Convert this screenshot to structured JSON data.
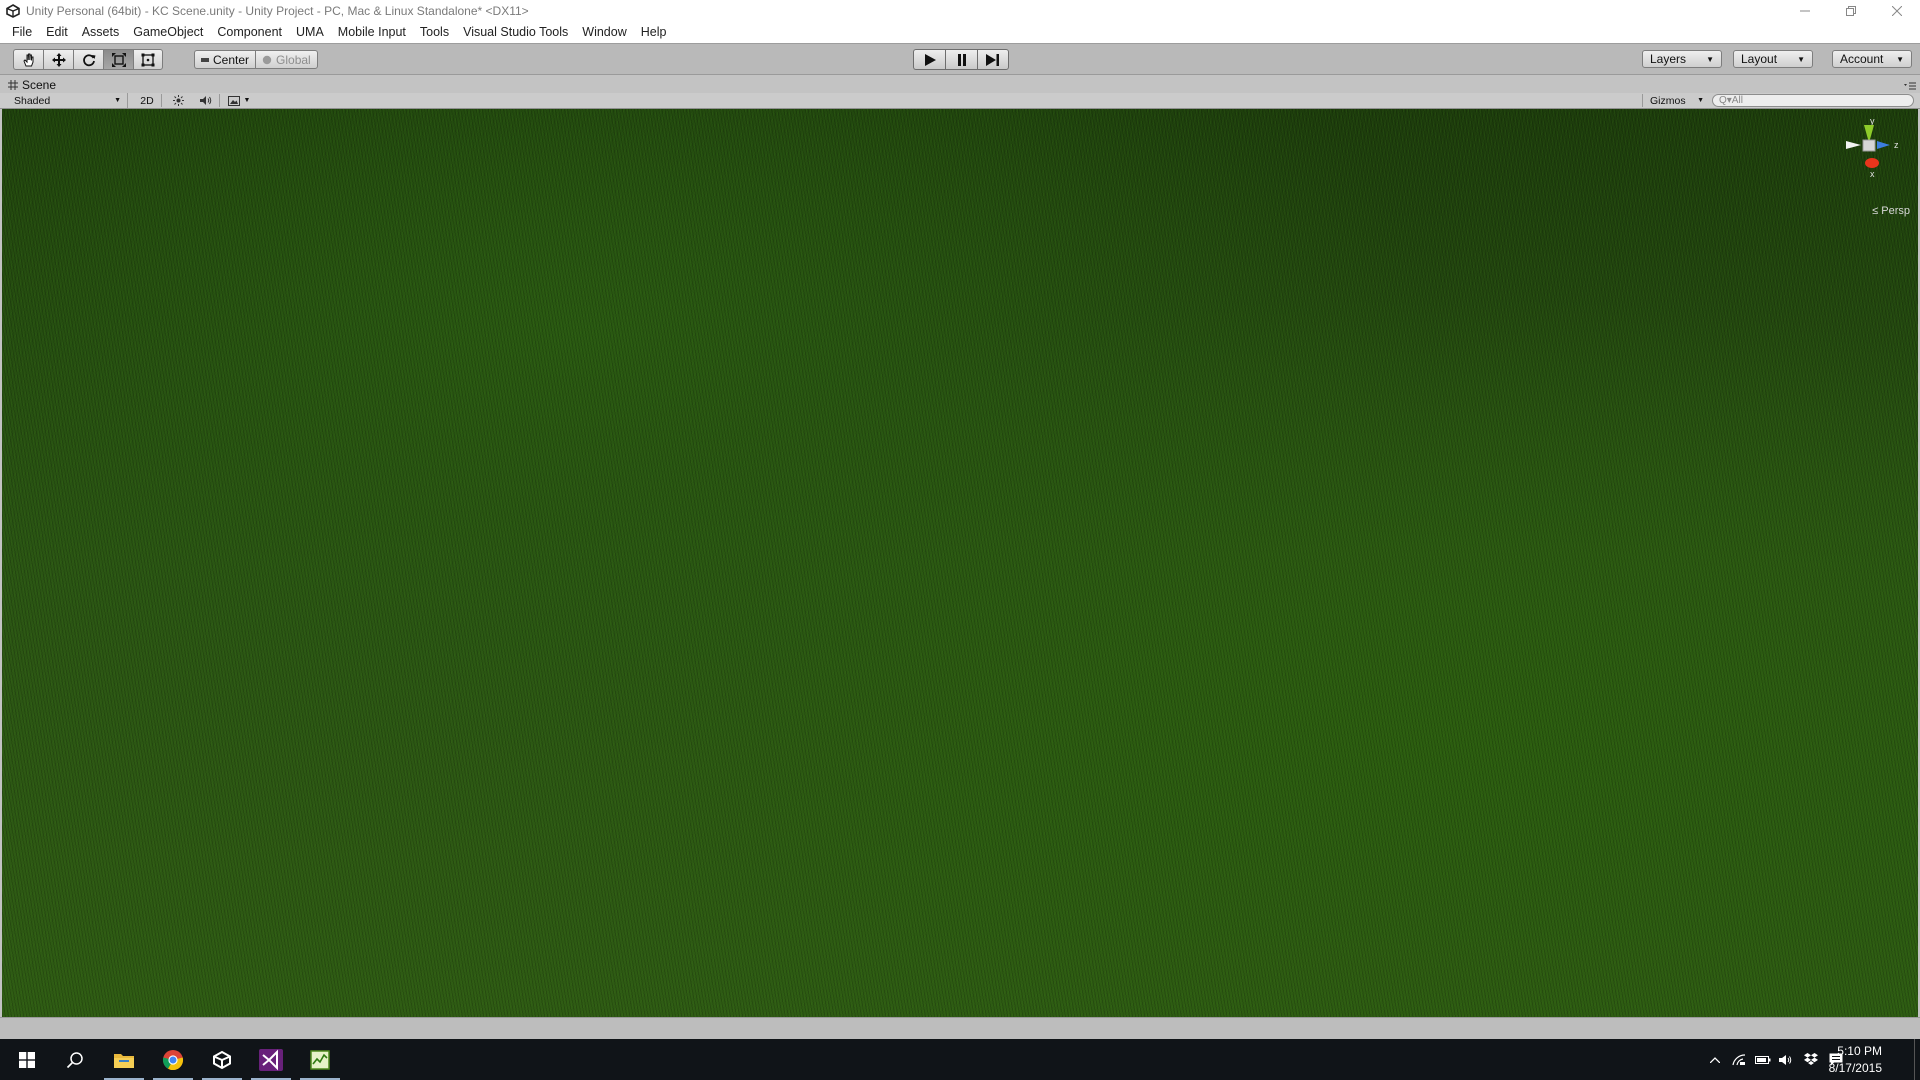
{
  "window": {
    "title": "Unity Personal (64bit) - KC Scene.unity - Unity Project - PC, Mac & Linux Standalone* <DX11>"
  },
  "menu": [
    "File",
    "Edit",
    "Assets",
    "GameObject",
    "Component",
    "UMA",
    "Mobile Input",
    "Tools",
    "Visual Studio Tools",
    "Window",
    "Help"
  ],
  "toolbar": {
    "pivot_center": "Center",
    "pivot_global": "Global",
    "layers": "Layers",
    "layout": "Layout",
    "account": "Account"
  },
  "scene": {
    "tab_label": "Scene",
    "draw_mode": "Shaded",
    "mode_2d": "2D",
    "gizmos": "Gizmos",
    "search_placeholder": "Q▾All",
    "persp": "Persp",
    "axis_y": "y",
    "axis_z": "z",
    "axis_x": "x"
  },
  "taskbar": {
    "time": "5:10 PM",
    "date": "8/17/2015"
  },
  "colors": {
    "axis_x": "#e8351c",
    "axis_y": "#8ecb2a",
    "axis_z": "#3c7ee0"
  }
}
